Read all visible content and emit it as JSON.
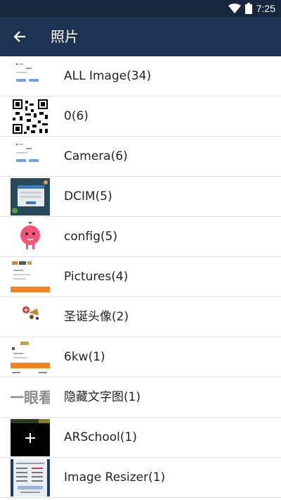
{
  "status_bar": {
    "time": "7:25"
  },
  "app_bar": {
    "title": "照片"
  },
  "albums": [
    {
      "label": "ALL Image(34)"
    },
    {
      "label": "0(6)"
    },
    {
      "label": "Camera(6)"
    },
    {
      "label": "DCIM(5)"
    },
    {
      "label": "config(5)"
    },
    {
      "label": "Pictures(4)"
    },
    {
      "label": "圣诞头像(2)"
    },
    {
      "label": "6kw(1)"
    },
    {
      "label": "隐藏文字图(1)"
    },
    {
      "label": "ARSchool(1)"
    },
    {
      "label": "Image Resizer(1)"
    }
  ],
  "thumb_text": {
    "hidden": "一眼看"
  },
  "colors": {
    "status_bar": "#16263d",
    "app_bar": "#1e3352",
    "accent_orange": "#f5841f"
  }
}
